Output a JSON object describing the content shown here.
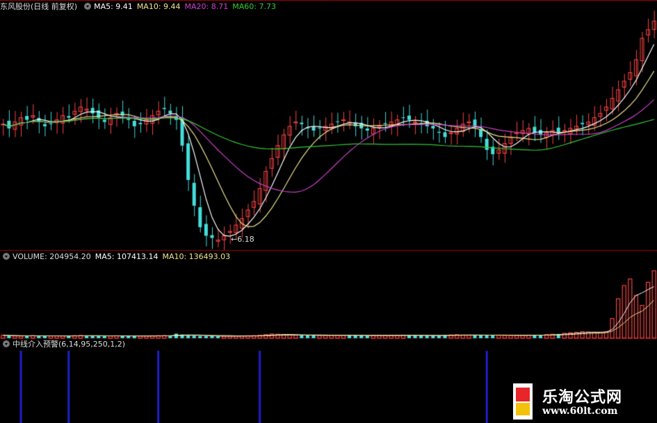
{
  "price_panel": {
    "title": "东风股份(日线 前复权)",
    "ma5": {
      "label": "MA5: 9.41",
      "color": "#ffffff"
    },
    "ma10": {
      "label": "MA10: 9.44",
      "color": "#f0e68c"
    },
    "ma20": {
      "label": "MA20: 8.71",
      "color": "#d040d0"
    },
    "ma60": {
      "label": "MA60: 7.73",
      "color": "#33cc33"
    },
    "low_label": "←6.18"
  },
  "volume_panel": {
    "title": "VOLUME: 204954.20",
    "ma5": {
      "label": "MA5: 107413.14",
      "color": "#ffffff"
    },
    "ma10": {
      "label": "MA10: 136493.03",
      "color": "#f0e68c"
    }
  },
  "indicator_panel": {
    "title": "中线介入预警(6,14,95,250,1,2)"
  },
  "colors": {
    "up": "#ff4444",
    "down": "#44dddd",
    "signal": "#2020cc",
    "divider": "#aa0000"
  },
  "watermark": {
    "cn": "乐淘公式网",
    "url": "www.60lt.com"
  },
  "chart_data": {
    "type": "candlestick",
    "price": {
      "ylim": [
        6.0,
        11.5
      ],
      "closes": [
        8.9,
        8.8,
        8.95,
        9.05,
        9.0,
        9.1,
        8.95,
        8.85,
        8.9,
        9.0,
        9.1,
        9.05,
        9.2,
        9.3,
        9.25,
        9.15,
        9.05,
        8.95,
        9.05,
        9.15,
        9.1,
        9.0,
        8.85,
        8.9,
        9.0,
        9.1,
        9.2,
        9.25,
        9.15,
        9.0,
        8.4,
        7.6,
        7.0,
        6.5,
        6.3,
        6.25,
        6.2,
        6.3,
        6.4,
        6.55,
        6.7,
        6.9,
        7.1,
        7.4,
        7.8,
        8.1,
        8.4,
        8.65,
        8.85,
        8.95,
        8.9,
        8.8,
        8.75,
        8.8,
        8.85,
        8.9,
        8.95,
        9.0,
        8.95,
        8.85,
        8.8,
        8.75,
        8.8,
        8.85,
        8.9,
        8.95,
        9.0,
        9.05,
        9.0,
        8.95,
        8.9,
        8.85,
        8.8,
        8.7,
        8.6,
        8.7,
        8.8,
        8.9,
        8.95,
        8.85,
        8.6,
        8.3,
        8.2,
        8.3,
        8.45,
        8.6,
        8.7,
        8.75,
        8.8,
        8.7,
        8.65,
        8.7,
        8.75,
        8.7,
        8.75,
        8.8,
        8.85,
        8.9,
        8.95,
        9.05,
        9.15,
        9.3,
        9.5,
        9.7,
        9.9,
        10.1,
        10.4,
        10.9,
        11.1,
        11.3
      ],
      "low": 6.18
    },
    "volume": {
      "ylim": [
        0,
        230000
      ],
      "values": [
        9000,
        8000,
        7000,
        6500,
        7000,
        8000,
        7500,
        7000,
        6800,
        7000,
        7200,
        6900,
        8000,
        8500,
        8000,
        7600,
        7000,
        6800,
        7000,
        7400,
        7200,
        6900,
        6500,
        6800,
        7000,
        7500,
        8000,
        8200,
        7800,
        14000,
        11000,
        9000,
        8000,
        7000,
        6500,
        6200,
        6000,
        6300,
        6600,
        7000,
        7300,
        7600,
        8000,
        9000,
        11000,
        13000,
        12000,
        11000,
        10000,
        9000,
        8800,
        8600,
        8400,
        8500,
        8700,
        9000,
        9200,
        9000,
        8800,
        8500,
        8200,
        8000,
        8100,
        8300,
        8500,
        8700,
        9000,
        9200,
        9000,
        8700,
        8400,
        8100,
        8000,
        7800,
        9000,
        10000,
        11000,
        10000,
        9500,
        9000,
        9500,
        10000,
        9500,
        9000,
        8500,
        8400,
        8600,
        9000,
        9400,
        9800,
        10000,
        11000,
        12000,
        13000,
        15000,
        17000,
        18000,
        20000,
        19000,
        18000,
        17000,
        20000,
        60000,
        120000,
        160000,
        180000,
        130000,
        100000,
        170000,
        204954
      ],
      "ma5_last": 107413.14,
      "ma10_last": 136493.03
    },
    "signals_x_index": [
      3,
      11,
      26,
      43,
      81
    ]
  }
}
